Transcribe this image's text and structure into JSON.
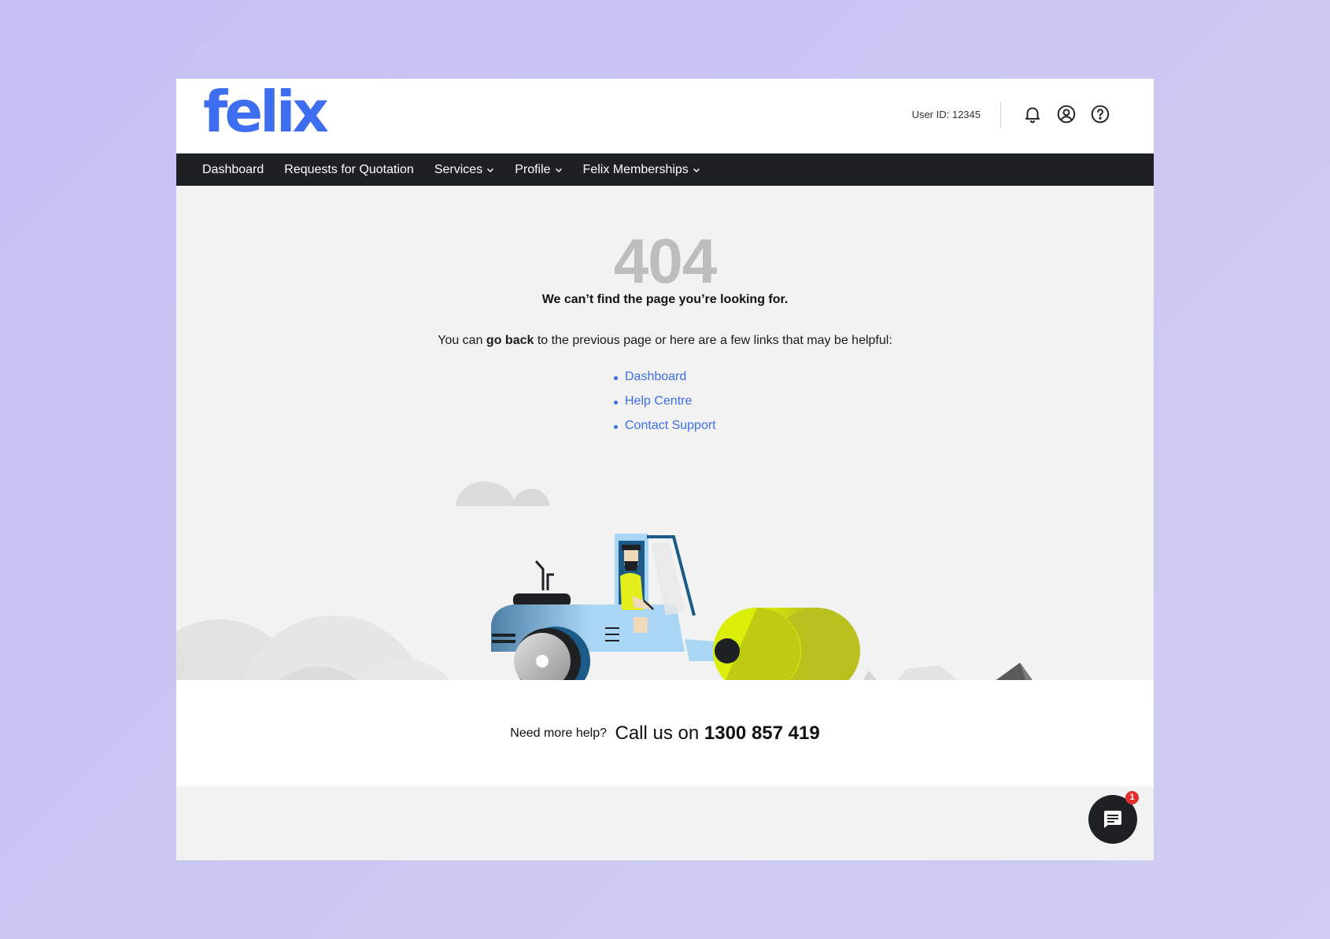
{
  "brand": {
    "logo_text": "felix",
    "color": "#3d6ef0"
  },
  "header": {
    "user_id": "User ID: 12345",
    "icons": [
      "bell-icon",
      "account-icon",
      "help-icon"
    ]
  },
  "nav": {
    "items": [
      {
        "label": "Dashboard",
        "dropdown": false
      },
      {
        "label": "Requests for Quotation",
        "dropdown": false
      },
      {
        "label": "Services",
        "dropdown": true
      },
      {
        "label": "Profile",
        "dropdown": true
      },
      {
        "label": "Felix Memberships",
        "dropdown": true
      }
    ]
  },
  "error": {
    "code": "404",
    "headline": "We can’t find the page you’re looking for.",
    "sub_prefix": "You can ",
    "sub_bold": "go back",
    "sub_suffix": " to the previous page or here are a few links that may be helpful:"
  },
  "helpful_links": [
    "Dashboard",
    "Help Centre",
    "Contact Support"
  ],
  "footer": {
    "need_help": "Need more help?",
    "call_prefix": "Call us on",
    "phone": "1300 857 419"
  },
  "chat": {
    "icon": "chat-icon",
    "badge_count": "1"
  },
  "colors": {
    "accent": "#3d6ef0",
    "nav_bg": "#1e2124",
    "badge": "#e3302f",
    "roller": "#dbee0a",
    "vehicle": "#a9d6f5"
  }
}
